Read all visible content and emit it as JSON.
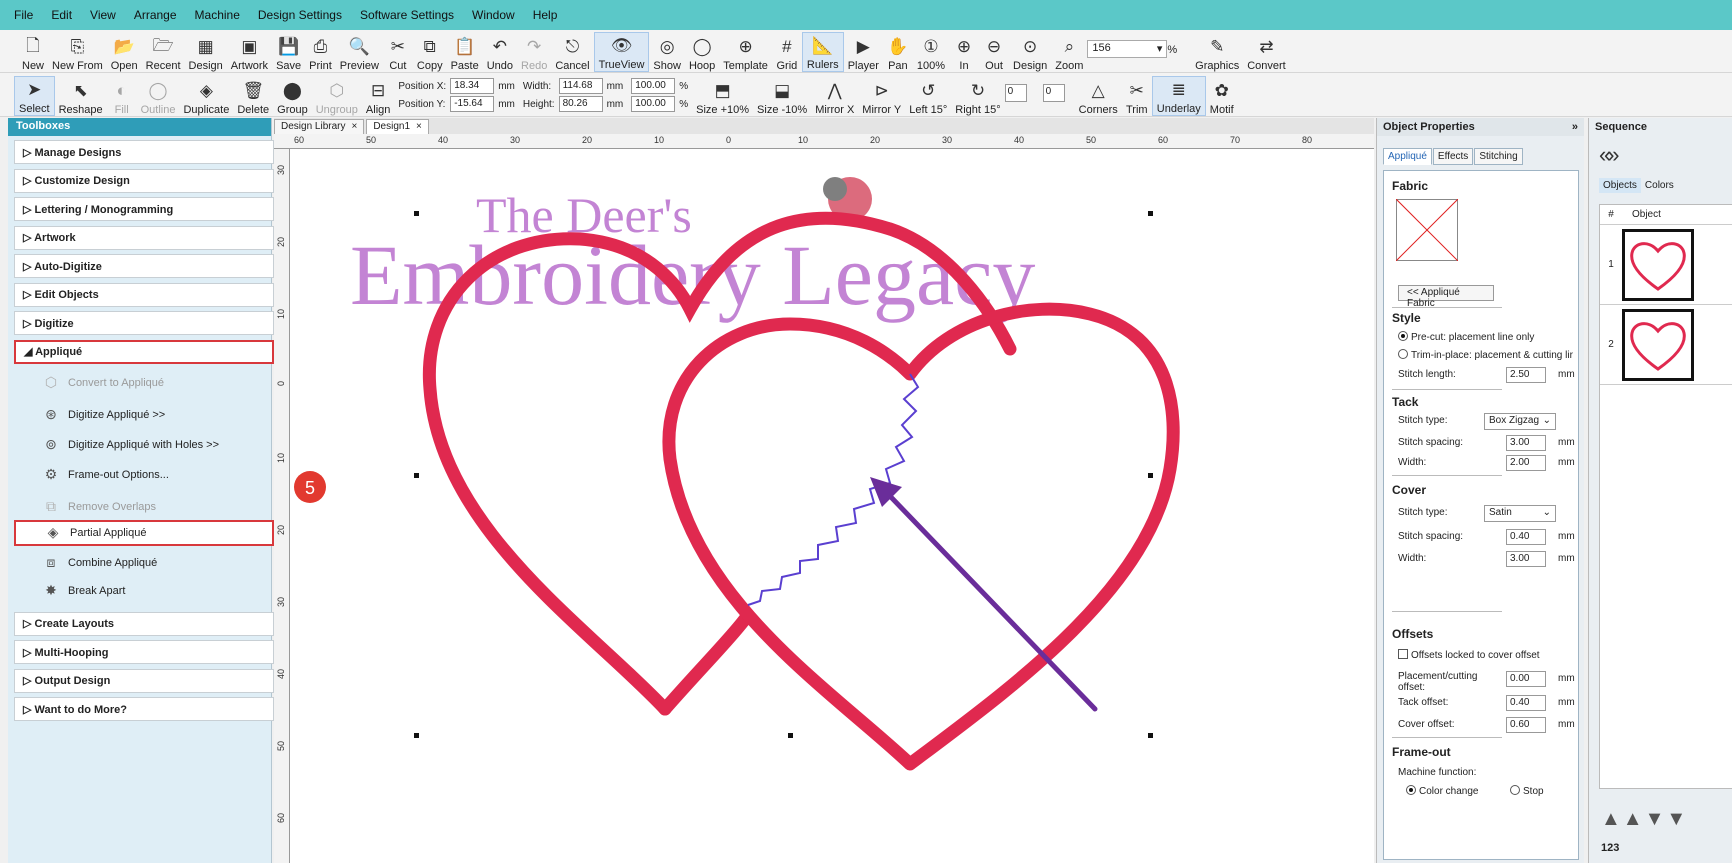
{
  "menu": [
    "File",
    "Edit",
    "View",
    "Arrange",
    "Machine",
    "Design Settings",
    "Software Settings",
    "Window",
    "Help"
  ],
  "toolbar1": [
    {
      "label": "New",
      "icon": "new-document-icon"
    },
    {
      "label": "New From",
      "icon": "new-from-icon"
    },
    {
      "label": "Open",
      "icon": "open-folder-icon"
    },
    {
      "label": "Recent",
      "icon": "recent-folder-icon"
    },
    {
      "label": "Design",
      "icon": "design-icon"
    },
    {
      "label": "Artwork",
      "icon": "artwork-icon"
    },
    {
      "label": "Save",
      "icon": "save-icon"
    },
    {
      "label": "Print",
      "icon": "print-icon"
    },
    {
      "label": "Preview",
      "icon": "preview-icon"
    },
    {
      "label": "Cut",
      "icon": "cut-icon"
    },
    {
      "label": "Copy",
      "icon": "copy-icon"
    },
    {
      "label": "Paste",
      "icon": "paste-icon"
    },
    {
      "label": "Undo",
      "icon": "undo-icon"
    },
    {
      "label": "Redo",
      "icon": "redo-icon",
      "disabled": true
    },
    {
      "label": "Cancel",
      "icon": "esc-icon"
    },
    {
      "label": "TrueView",
      "icon": "trueview-icon",
      "active": true
    },
    {
      "label": "Show",
      "icon": "show-icon"
    },
    {
      "label": "Hoop",
      "icon": "hoop-icon"
    },
    {
      "label": "Template",
      "icon": "template-icon"
    },
    {
      "label": "Grid",
      "icon": "grid-icon"
    },
    {
      "label": "Rulers",
      "icon": "rulers-icon",
      "active": true
    },
    {
      "label": "Player",
      "icon": "player-icon"
    },
    {
      "label": "Pan",
      "icon": "pan-icon"
    },
    {
      "label": "100%",
      "icon": "zoom-100-icon"
    },
    {
      "label": "In",
      "icon": "zoom-in-icon"
    },
    {
      "label": "Out",
      "icon": "zoom-out-icon"
    },
    {
      "label": "Design",
      "icon": "zoom-design-icon"
    },
    {
      "label": "Zoom",
      "icon": "zoom-icon"
    }
  ],
  "zoom_value": "156",
  "zoom_unit": "%",
  "toolbar1_right": [
    {
      "label": "Graphics",
      "icon": "graphics-icon"
    },
    {
      "label": "Convert",
      "icon": "convert-icon"
    }
  ],
  "toolbar2_left": [
    {
      "label": "Select",
      "icon": "select-arrow-icon",
      "active": true
    },
    {
      "label": "Reshape",
      "icon": "reshape-icon"
    },
    {
      "label": "Fill",
      "icon": "fill-icon",
      "disabled": true
    },
    {
      "label": "Outline",
      "icon": "outline-icon",
      "disabled": true
    },
    {
      "label": "Duplicate",
      "icon": "duplicate-icon"
    },
    {
      "label": "Delete",
      "icon": "delete-icon"
    },
    {
      "label": "Group",
      "icon": "group-icon"
    },
    {
      "label": "Ungroup",
      "icon": "ungroup-icon",
      "disabled": true
    },
    {
      "label": "Align",
      "icon": "align-icon"
    }
  ],
  "position": {
    "x_label": "Position X:",
    "x_value": "18.34",
    "y_label": "Position Y:",
    "y_value": "-15.64",
    "width_label": "Width:",
    "width_value": "114.68",
    "height_label": "Height:",
    "height_value": "80.26",
    "unit": "mm",
    "scale_w": "100.00",
    "scale_h": "100.00",
    "pct": "%"
  },
  "toolbar2_right": [
    {
      "label": "Size +10%",
      "icon": "size-up-icon"
    },
    {
      "label": "Size -10%",
      "icon": "size-down-icon"
    },
    {
      "label": "Mirror X",
      "icon": "mirror-x-icon"
    },
    {
      "label": "Mirror Y",
      "icon": "mirror-y-icon"
    },
    {
      "label": "Left 15°",
      "icon": "rotate-left-icon"
    },
    {
      "label": "Right 15°",
      "icon": "rotate-right-icon"
    }
  ],
  "rotate_value": "0",
  "skew_value": "0",
  "toolbar2_far": [
    {
      "label": "Corners",
      "icon": "corners-icon"
    },
    {
      "label": "Trim",
      "icon": "trim-icon"
    },
    {
      "label": "Underlay",
      "icon": "underlay-icon",
      "active": true
    },
    {
      "label": "Motif",
      "icon": "motif-icon"
    }
  ],
  "toolbox": {
    "title": "Toolboxes",
    "sections_top": [
      "Manage Designs",
      "Customize Design",
      "Lettering / Monogramming",
      "Artwork",
      "Auto-Digitize",
      "Edit Objects",
      "Digitize"
    ],
    "expanded": "Appliqué",
    "items": [
      {
        "label": "Convert to Appliqué",
        "icon": "convert-applique-icon",
        "disabled": true
      },
      {
        "label": "Digitize Appliqué >>",
        "icon": "digitize-applique-icon"
      },
      {
        "label": "Digitize Appliqué with Holes >>",
        "icon": "digitize-holes-icon"
      },
      {
        "label": "Frame-out Options...",
        "icon": "frame-out-icon"
      },
      {
        "label": "Remove Overlaps",
        "icon": "remove-overlaps-icon",
        "disabled": true
      },
      {
        "label": "Partial Appliqué",
        "icon": "partial-applique-icon",
        "highlight": true
      },
      {
        "label": "Combine Appliqué",
        "icon": "combine-applique-icon"
      },
      {
        "label": "Break Apart",
        "icon": "break-apart-icon"
      }
    ],
    "sections_bottom": [
      "Create Layouts",
      "Multi-Hooping",
      "Output Design",
      "Want to do More?"
    ]
  },
  "step_badge": "5",
  "doc_tabs": [
    {
      "label": "Design Library",
      "active": false
    },
    {
      "label": "Design1",
      "active": true
    }
  ],
  "ruler_top": [
    "60",
    "50",
    "40",
    "30",
    "20",
    "10",
    "0",
    "10",
    "20",
    "30",
    "40",
    "50",
    "60",
    "70",
    "80"
  ],
  "ruler_left": [
    "30",
    "20",
    "10",
    "0",
    "10",
    "20",
    "30",
    "40",
    "50",
    "60"
  ],
  "watermark": {
    "line1": "The Deer's",
    "line2": "Embroidery Legacy"
  },
  "colors": {
    "heart": "#e0294f",
    "arrow": "#6a2d9a",
    "zigzag": "#5a3fd0",
    "watermark": "#b05cc6",
    "highlight": "#d8383c"
  },
  "properties": {
    "title": "Object Properties",
    "tabs": [
      "Appliqué",
      "Effects",
      "Stitching"
    ],
    "fabric_head": "Fabric",
    "fabric_button": "<< Appliqué Fabric",
    "style_head": "Style",
    "style_options": [
      "Pre-cut: placement line only",
      "Trim-in-place: placement & cutting lir"
    ],
    "stitch_length_label": "Stitch length:",
    "stitch_length": "2.50",
    "tack_head": "Tack",
    "tack_type_label": "Stitch type:",
    "tack_type": "Box Zigzag",
    "tack_spacing_label": "Stitch spacing:",
    "tack_spacing": "3.00",
    "tack_width_label": "Width:",
    "tack_width": "2.00",
    "cover_head": "Cover",
    "cover_type_label": "Stitch type:",
    "cover_type": "Satin",
    "cover_spacing_label": "Stitch spacing:",
    "cover_spacing": "0.40",
    "cover_width_label": "Width:",
    "cover_width": "3.00",
    "unit": "mm",
    "offsets_head": "Offsets",
    "offsets_locked": "Offsets locked to cover offset",
    "placement_label": "Placement/cutting offset:",
    "placement": "0.00",
    "tack_offset_label": "Tack offset:",
    "tack_offset": "0.40",
    "cover_offset_label": "Cover offset:",
    "cover_offset": "0.60",
    "frameout_head": "Frame-out",
    "machine_fn_label": "Machine function:",
    "machine_fn_options": [
      "Color change",
      "Stop"
    ]
  },
  "sequence": {
    "title": "Sequence",
    "tabs": [
      "Objects",
      "Colors"
    ],
    "col_num": "#",
    "col_obj": "Object",
    "rows": [
      "1",
      "2"
    ],
    "footer": "123"
  }
}
